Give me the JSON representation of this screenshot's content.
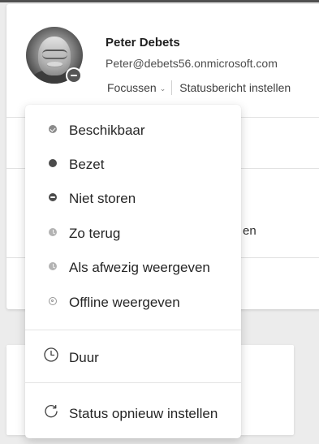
{
  "profile": {
    "name": "Peter Debets",
    "email": "Peter@debets56.onmicrosoft.com",
    "focus_label": "Focussen",
    "status_message_label": "Statusbericht instellen",
    "presence_icon": "do-not-disturb-icon"
  },
  "background": {
    "partial_text": "en"
  },
  "status_menu": {
    "items": [
      {
        "label": "Beschikbaar",
        "icon": "available-icon"
      },
      {
        "label": "Bezet",
        "icon": "busy-icon"
      },
      {
        "label": "Niet storen",
        "icon": "do-not-disturb-icon"
      },
      {
        "label": "Zo terug",
        "icon": "be-right-back-icon"
      },
      {
        "label": "Als afwezig weergeven",
        "icon": "appear-away-icon"
      },
      {
        "label": "Offline weergeven",
        "icon": "appear-offline-icon"
      }
    ],
    "duration_label": "Duur",
    "reset_label": "Status opnieuw instellen"
  },
  "colors": {
    "text": "#262626",
    "muted_text": "#4d4d4d",
    "presence_gray": "#4b4b4b",
    "surface": "#ffffff",
    "page_background": "#ececec"
  }
}
